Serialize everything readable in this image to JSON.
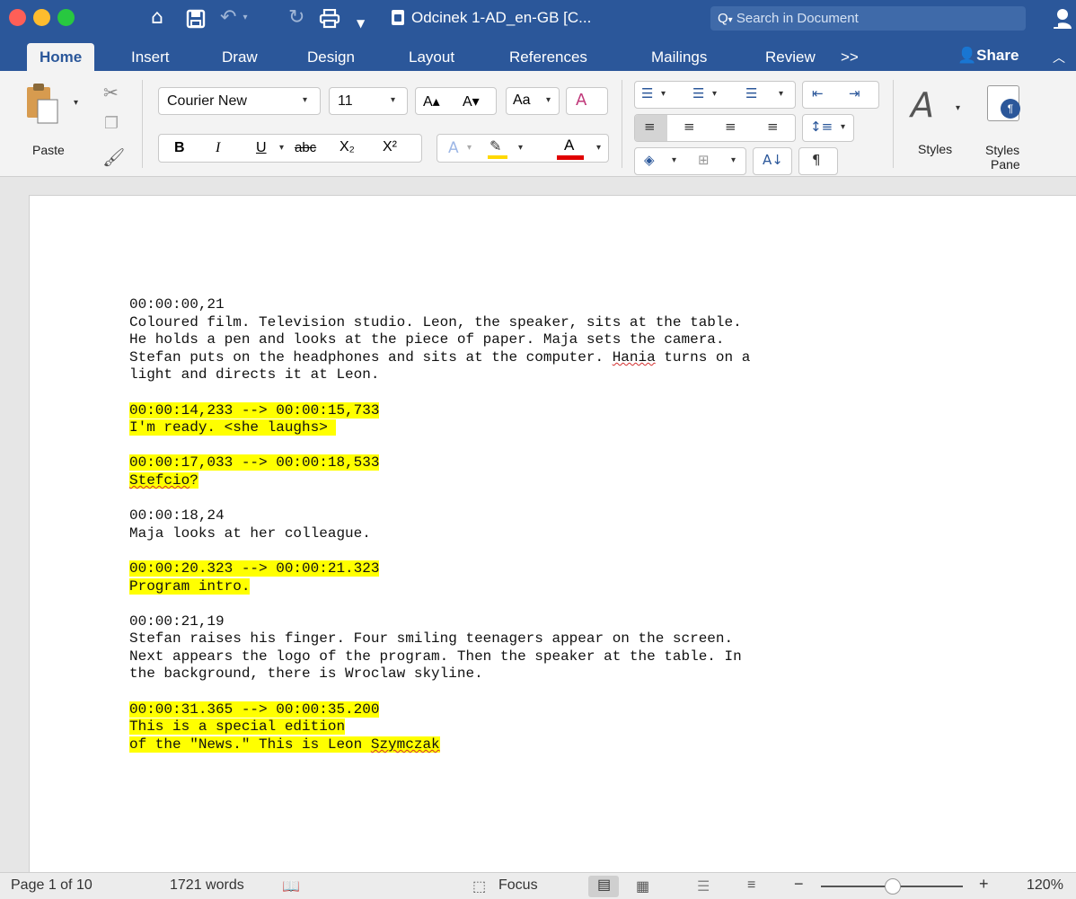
{
  "titlebar": {
    "doc_title": "Odcinek 1-AD_en-GB [C...",
    "search_placeholder": "Search in Document"
  },
  "tabs": {
    "items": [
      "Home",
      "Insert",
      "Draw",
      "Design",
      "Layout",
      "References",
      "Mailings",
      "Review"
    ],
    "more": ">>",
    "share": "Share"
  },
  "ribbon": {
    "paste_label": "Paste",
    "font_name": "Courier New",
    "font_size": "11",
    "bold": "B",
    "italic": "I",
    "underline": "U",
    "strike": "abc",
    "sub": "X₂",
    "sup": "X²",
    "grow": "A▴",
    "shrink": "A▾",
    "change_case": "Aa",
    "font_color_letter": "A",
    "styles_label": "Styles",
    "styles_pane_label_1": "Styles",
    "styles_pane_label_2": "Pane",
    "font_color": "#e00000",
    "highlight_color": "#ffd800"
  },
  "document": {
    "lines": [
      {
        "text": "00:00:00,21",
        "hl": false
      },
      {
        "text": "Coloured film. Television studio. Leon, the speaker, sits at the table.",
        "hl": false
      },
      {
        "text": "He holds a pen and looks at the piece of paper. Maja sets the camera.",
        "hl": false
      },
      {
        "text": "Stefan puts on the headphones and sits at the computer. Hania turns on a",
        "hl": false,
        "squiggle": "Hania"
      },
      {
        "text": "light and directs it at Leon.",
        "hl": false
      },
      {
        "text": "",
        "hl": false
      },
      {
        "text": "00:00:14,233 --> 00:00:15,733",
        "hl": true
      },
      {
        "text": "I'm ready. <she laughs> ",
        "hl": true
      },
      {
        "text": "",
        "hl": false
      },
      {
        "text": "00:00:17,033 --> 00:00:18,533",
        "hl": true
      },
      {
        "text": "Stefcio?",
        "hl": true,
        "squiggle": "Stefcio"
      },
      {
        "text": "",
        "hl": false
      },
      {
        "text": "00:00:18,24",
        "hl": false
      },
      {
        "text": "Maja looks at her colleague.",
        "hl": false
      },
      {
        "text": "",
        "hl": false
      },
      {
        "text": "00:00:20.323 --> 00:00:21.323",
        "hl": true
      },
      {
        "text": "Program intro.",
        "hl": true
      },
      {
        "text": "",
        "hl": false
      },
      {
        "text": "00:00:21,19",
        "hl": false
      },
      {
        "text": "Stefan raises his finger. Four smiling teenagers appear on the screen.",
        "hl": false
      },
      {
        "text": "Next appears the logo of the program. Then the speaker at the table. In",
        "hl": false
      },
      {
        "text": "the background, there is Wroclaw skyline.",
        "hl": false
      },
      {
        "text": "",
        "hl": false
      },
      {
        "text": "00:00:31.365 --> 00:00:35.200",
        "hl": true
      },
      {
        "text": "This is a special edition",
        "hl": true
      },
      {
        "text": "of the \"News.\" This is Leon Szymczak",
        "hl": true,
        "squiggle": "Szymczak"
      }
    ]
  },
  "statusbar": {
    "page": "Page 1 of 10",
    "words": "1721 words",
    "focus": "Focus",
    "zoom_minus": "−",
    "zoom_plus": "+",
    "zoom": "120%"
  }
}
